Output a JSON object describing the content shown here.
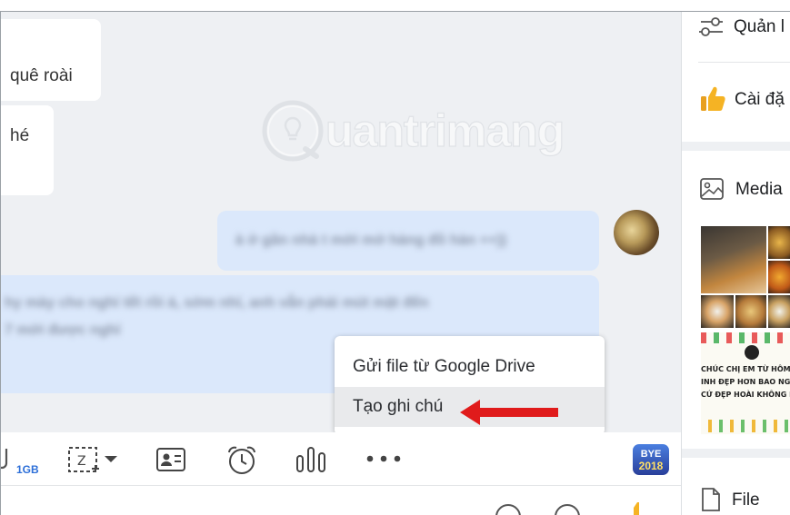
{
  "chat": {
    "incoming": [
      {
        "text": "quê roài"
      },
      {
        "text": "hé"
      }
    ],
    "watermark": "uantrimang"
  },
  "menu": {
    "items": [
      {
        "label": "Gửi file từ Google Drive",
        "highlighted": false
      },
      {
        "label": "Tạo ghi chú",
        "highlighted": true
      }
    ]
  },
  "toolbar": {
    "storage_badge": "1GB",
    "bye_badge_top": "BYE",
    "bye_badge_bottom": "2018",
    "icons": [
      "attach-icon",
      "screenshot-icon",
      "contact-card-icon",
      "alarm-clock-icon",
      "poll-icon",
      "more-icon",
      "bye-2018-sticker-icon"
    ]
  },
  "right_panel": {
    "manage_label": "Quản l",
    "settings_label": "Cài đặ",
    "media_label": "Media",
    "file_label": "File"
  },
  "colors": {
    "chat_bg": "#eef0f3",
    "outgoing_bubble": "#dbe8fb",
    "menu_highlight": "#e9eaec",
    "arrow_red": "#e01b1b",
    "accent_blue": "#2d6fd8"
  }
}
